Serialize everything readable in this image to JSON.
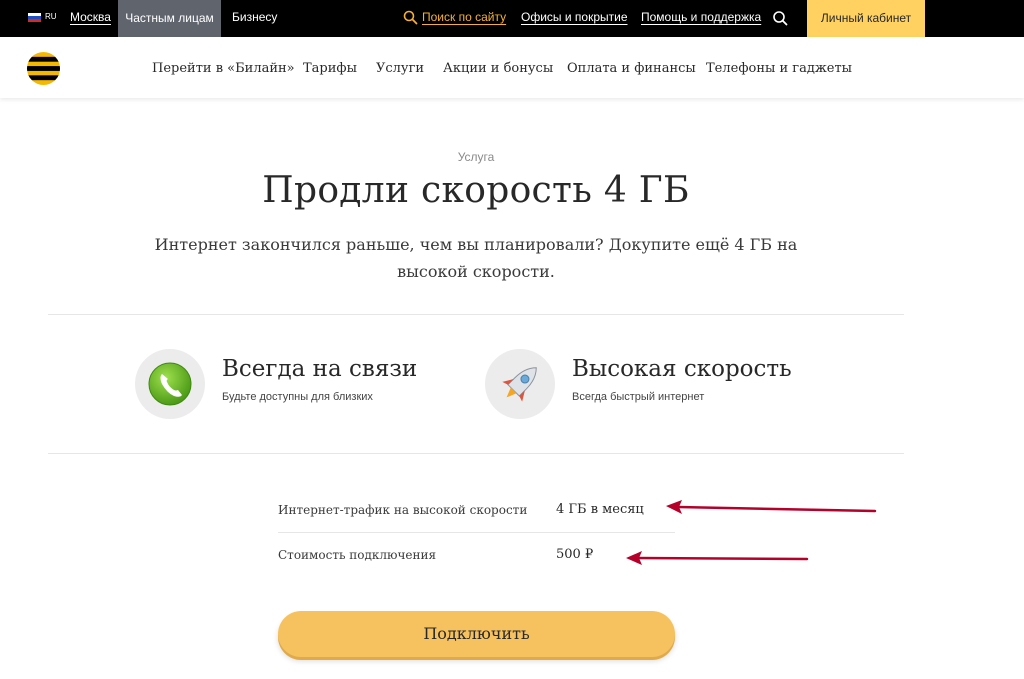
{
  "topbar": {
    "lang": "RU",
    "city": "Москва",
    "segment_active": "Частным лицам",
    "segment_business": "Бизнесу",
    "search_link": "Поиск по сайту",
    "offices": "Офисы и покрытие",
    "help": "Помощь и поддержка",
    "cabinet": "Личный кабинет",
    "accent_color": "#fed161",
    "search_color": "#f4b033"
  },
  "nav": {
    "items": [
      "Перейти в «Билайн»",
      "Тарифы",
      "Услуги",
      "Акции и бонусы",
      "Оплата и финансы",
      "Телефоны и гаджеты"
    ]
  },
  "hero": {
    "eyebrow": "Услуга",
    "title": "Продли скорость 4 ГБ",
    "description": "Интернет закончился раньше, чем вы планировали? Докупите ещё 4 ГБ на высокой скорости."
  },
  "features": [
    {
      "icon": "phone-icon",
      "title": "Всегда на связи",
      "subtitle": "Будьте доступны для близких"
    },
    {
      "icon": "rocket-icon",
      "title": "Высокая скорость",
      "subtitle": "Всегда быстрый интернет"
    }
  ],
  "params": [
    {
      "label": "Интернет-трафик на высокой скорости",
      "value": "4 ГБ в месяц"
    },
    {
      "label": "Стоимость подключения",
      "value": "500 ₽"
    }
  ],
  "connect_label": "Подключить",
  "arrow_color": "#b5002a"
}
